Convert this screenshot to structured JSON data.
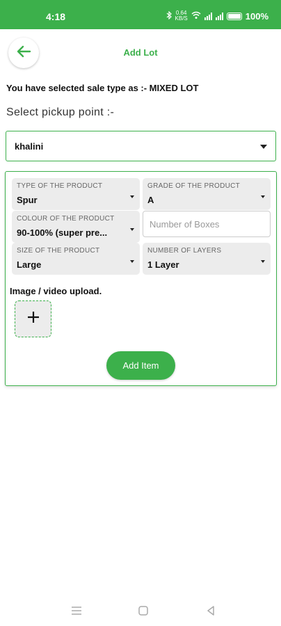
{
  "status_bar": {
    "time": "4:18",
    "net_speed_value": "0.64",
    "net_speed_unit": "KB/S",
    "battery_pct": "100%"
  },
  "header": {
    "title": "Add Lot",
    "back_icon": "arrow-left-icon"
  },
  "sale_type_text": "You have selected sale type as :- MIXED LOT",
  "pickup": {
    "label": "Select pickup  point :-",
    "selected": "khalini"
  },
  "product_form": {
    "type": {
      "label": "TYPE OF THE PRODUCT",
      "value": "Spur"
    },
    "grade": {
      "label": "GRADE OF THE PRODUCT",
      "value": "A"
    },
    "colour": {
      "label": "COLOUR OF THE PRODUCT",
      "value": "90-100% (super pre..."
    },
    "boxes": {
      "placeholder": "Number of Boxes",
      "value": ""
    },
    "size": {
      "label": "SIZE OF THE PRODUCT",
      "value": "Large"
    },
    "layers": {
      "label": "NUMBER OF LAYERS",
      "value": "1 Layer"
    },
    "upload_label": "Image / video upload.",
    "add_item_label": "Add Item"
  },
  "colors": {
    "accent": "#3cb04b",
    "field_bg": "#ececec"
  },
  "nav": [
    "recents-icon",
    "home-icon",
    "back-icon"
  ]
}
